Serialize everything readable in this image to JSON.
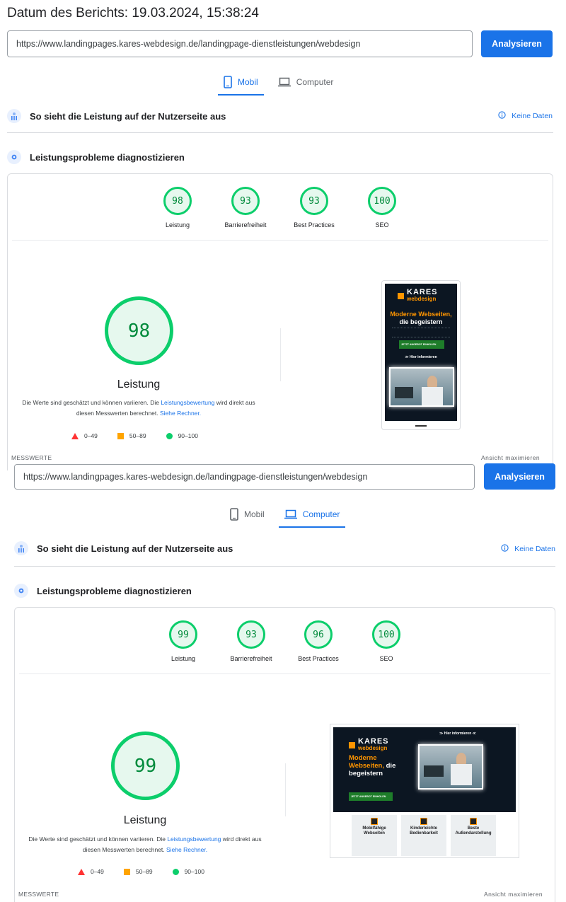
{
  "report_date": "Datum des Berichts: 19.03.2024, 15:38:24",
  "mobile": {
    "url": "https://www.landingpages.kares-webdesign.de/landingpage-dienstleistungen/webdesign",
    "analyze_label": "Analysieren",
    "tabs": [
      {
        "label": "Mobil",
        "active": true
      },
      {
        "label": "Computer",
        "active": false
      }
    ],
    "user_experience_title": "So sieht die Leistung auf der Nutzerseite aus",
    "no_data_label": "Keine Daten",
    "diagnose_title": "Leistungsprobleme diagnostizieren",
    "scores": [
      {
        "label": "Leistung",
        "value": "98"
      },
      {
        "label": "Barrierefreiheit",
        "value": "93"
      },
      {
        "label": "Best Practices",
        "value": "93"
      },
      {
        "label": "SEO",
        "value": "100"
      }
    ],
    "main_score": "98",
    "main_label": "Leistung",
    "note_part1": "Die Werte sind geschätzt und können variieren. Die ",
    "note_link1": "Leistungsbewertung",
    "note_part2": " wird direkt aus diesen Messwerten berechnet. ",
    "note_link2": "Siehe Rechner.",
    "legend": {
      "low": "0–49",
      "mid": "50–89",
      "high": "90–100"
    },
    "metrics_label": "MESSWERTE",
    "maximize_label": "Ansicht maximieren"
  },
  "desktop": {
    "url": "https://www.landingpages.kares-webdesign.de/landingpage-dienstleistungen/webdesign",
    "analyze_label": "Analysieren",
    "tabs": [
      {
        "label": "Mobil",
        "active": false
      },
      {
        "label": "Computer",
        "active": true
      }
    ],
    "user_experience_title": "So sieht die Leistung auf der Nutzerseite aus",
    "no_data_label": "Keine Daten",
    "diagnose_title": "Leistungsprobleme diagnostizieren",
    "scores": [
      {
        "label": "Leistung",
        "value": "99"
      },
      {
        "label": "Barrierefreiheit",
        "value": "93"
      },
      {
        "label": "Best Practices",
        "value": "96"
      },
      {
        "label": "SEO",
        "value": "100"
      }
    ],
    "main_score": "99",
    "main_label": "Leistung",
    "note_part1": "Die Werte sind geschätzt und können variieren. Die ",
    "note_link1": "Leistungsbewertung",
    "note_part2": " wird direkt aus diesen Messwerten berechnet. ",
    "note_link2": "Siehe Rechner.",
    "legend": {
      "low": "0–49",
      "mid": "50–89",
      "high": "90–100"
    },
    "metrics_label": "MESSWERTE",
    "maximize_label": "Ansicht maximieren"
  },
  "thumbnail": {
    "logo": "KARES",
    "logo_sub": "webdesign",
    "hero_line1": "Moderne Webseiten,",
    "hero_line2": "die begeistern",
    "desk_hero_line1": "Moderne",
    "desk_hero_line2": "Webseiten,",
    "desk_hero_line3": "die",
    "desk_hero_line4": "begeistern",
    "cta": "JETZT ANGEBOT EINHOLEN",
    "more_info": "Hier informieren",
    "features": [
      {
        "title": "Mobilfähige Webseiten"
      },
      {
        "title": "Kinderleichte Bedienbarkeit"
      },
      {
        "title": "Beste Außendarstellung"
      }
    ]
  },
  "colors": {
    "accent": "#1a73e8",
    "pass": "#0cce6b",
    "average": "#ffa400",
    "fail": "#ff3333",
    "brand_orange": "#ff9500"
  }
}
